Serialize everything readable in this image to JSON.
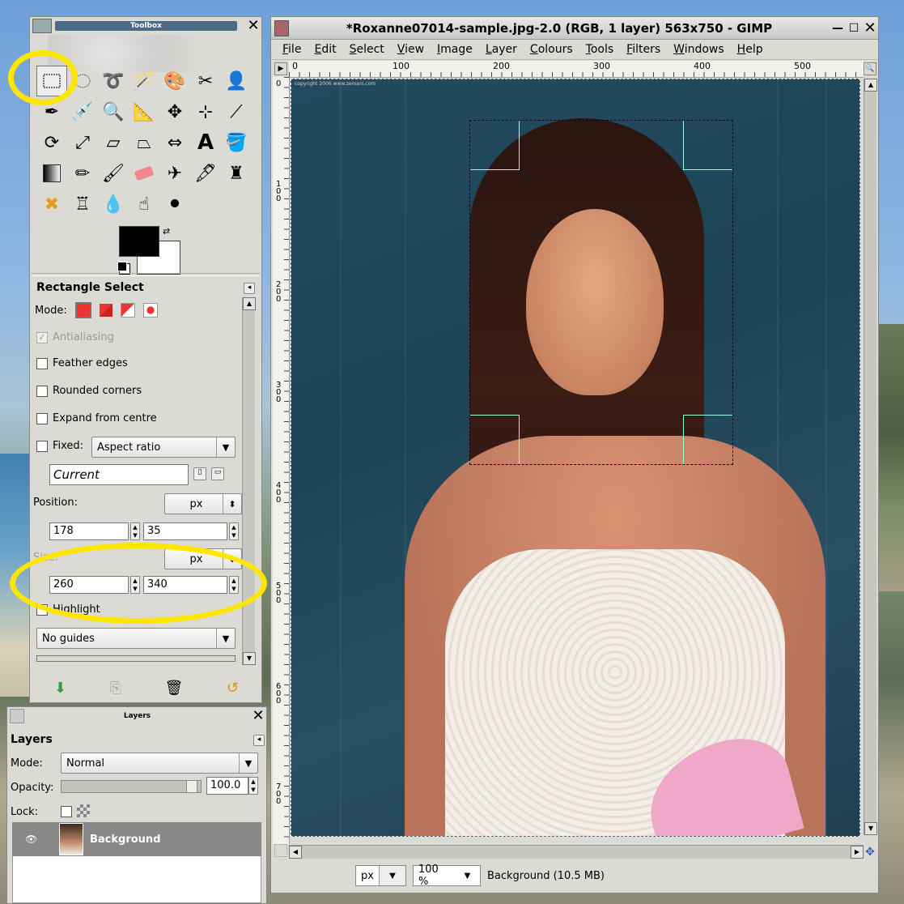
{
  "toolbox": {
    "title": "Toolbox",
    "tools": [
      "rect-select",
      "ellipse-select",
      "free-select",
      "fuzzy-select",
      "select-by-color",
      "scissors",
      "foreground-select",
      "paths",
      "color-picker",
      "zoom",
      "measure",
      "move",
      "align",
      "crop",
      "rotate",
      "scale",
      "shear",
      "perspective",
      "flip",
      "text",
      "color-fill",
      "blend",
      "pencil",
      "paintbrush",
      "eraser",
      "airbrush",
      "ink",
      "clone",
      "heal",
      "perspective-clone",
      "blur",
      "smudge",
      "dodge-burn"
    ],
    "colors": {
      "foreground": "#000000",
      "background": "#ffffff"
    }
  },
  "tool_options": {
    "title": "Rectangle Select",
    "mode_label": "Mode:",
    "antialiasing": "Antialiasing",
    "feather_edges": "Feather edges",
    "rounded_corners": "Rounded corners",
    "expand_from_centre": "Expand from centre",
    "fixed_label": "Fixed:",
    "fixed_option": "Aspect ratio",
    "fixed_value": "Current",
    "position_label": "Position:",
    "position_unit": "px",
    "position_x": "178",
    "position_y": "35",
    "size_label": "Size:",
    "size_unit": "px",
    "size_w": "260",
    "size_h": "340",
    "highlight": "Highlight",
    "guides": "No guides"
  },
  "layers": {
    "title": "Layers",
    "heading": "Layers",
    "mode_label": "Mode:",
    "mode_value": "Normal",
    "opacity_label": "Opacity:",
    "opacity_value": "100.0",
    "lock_label": "Lock:",
    "layer_name": "Background"
  },
  "image_window": {
    "title": "*Roxanne07014-sample.jpg-2.0 (RGB, 1 layer) 563x750 - GIMP",
    "menu": [
      "File",
      "Edit",
      "Select",
      "View",
      "Image",
      "Layer",
      "Colours",
      "Tools",
      "Filters",
      "Windows",
      "Help"
    ],
    "ruler_h": [
      "0",
      "100",
      "200",
      "300",
      "400",
      "500"
    ],
    "ruler_v": [
      "0",
      "100",
      "200",
      "300",
      "400",
      "500",
      "600",
      "700"
    ],
    "copyright": "copyright 2006 www.zemani.com",
    "unit": "px",
    "zoom": "100 %",
    "status": "Background (10.5 MB)"
  },
  "annotations": {
    "highlight_color": "#ffe600"
  }
}
